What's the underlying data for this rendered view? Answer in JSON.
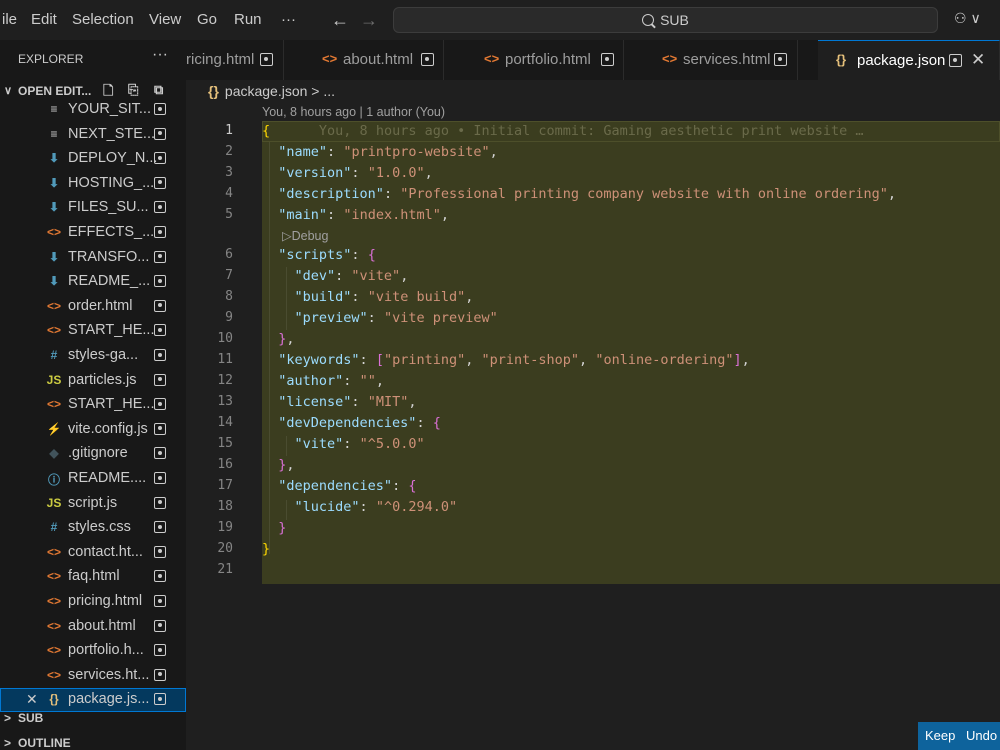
{
  "menu": {
    "file": "ile",
    "edit": "Edit",
    "selection": "Selection",
    "view": "View",
    "go": "Go",
    "run": "Run",
    "more": "···"
  },
  "nav": {
    "back": "←",
    "forward": "→"
  },
  "search": {
    "label": "SUB"
  },
  "copilot": {
    "label": "⚇ ∨"
  },
  "sidebar": {
    "title": "EXPLORER",
    "more": "···",
    "open_editors": "OPEN EDIT...",
    "files": [
      {
        "name": "YOUR_SIT...",
        "icon": "≡",
        "color": "#cccccc",
        "icon_name": "text-file-icon"
      },
      {
        "name": "NEXT_STE...",
        "icon": "≡",
        "color": "#cccccc",
        "icon_name": "text-file-icon"
      },
      {
        "name": "DEPLOY_N...",
        "icon": "⬇",
        "color": "#519aba",
        "icon_name": "markdown-icon"
      },
      {
        "name": "HOSTING_...",
        "icon": "⬇",
        "color": "#519aba",
        "icon_name": "markdown-icon"
      },
      {
        "name": "FILES_SU...",
        "icon": "⬇",
        "color": "#519aba",
        "icon_name": "markdown-icon"
      },
      {
        "name": "EFFECTS_...",
        "icon": "<>",
        "color": "#e37933",
        "icon_name": "html-icon"
      },
      {
        "name": "TRANSFO...",
        "icon": "⬇",
        "color": "#519aba",
        "icon_name": "markdown-icon"
      },
      {
        "name": "README_...",
        "icon": "⬇",
        "color": "#519aba",
        "icon_name": "markdown-icon"
      },
      {
        "name": "order.html",
        "icon": "<>",
        "color": "#e37933",
        "icon_name": "html-icon"
      },
      {
        "name": "START_HE...",
        "icon": "<>",
        "color": "#e37933",
        "icon_name": "html-icon"
      },
      {
        "name": "styles-ga...",
        "icon": "#",
        "color": "#519aba",
        "icon_name": "css-icon"
      },
      {
        "name": "particles.js",
        "icon": "JS",
        "color": "#cbcb41",
        "icon_name": "js-icon"
      },
      {
        "name": "START_HE...",
        "icon": "<>",
        "color": "#e37933",
        "icon_name": "html-icon"
      },
      {
        "name": "vite.config.js",
        "icon": "⚡",
        "color": "#cbcb41",
        "icon_name": "vite-icon"
      },
      {
        "name": ".gitignore",
        "icon": "◆",
        "color": "#41535b",
        "icon_name": "git-icon"
      },
      {
        "name": "README....",
        "icon": "ⓘ",
        "color": "#519aba",
        "icon_name": "info-icon"
      },
      {
        "name": "script.js",
        "icon": "JS",
        "color": "#cbcb41",
        "icon_name": "js-icon"
      },
      {
        "name": "styles.css",
        "icon": "#",
        "color": "#519aba",
        "icon_name": "css-icon"
      },
      {
        "name": "contact.ht...",
        "icon": "<>",
        "color": "#e37933",
        "icon_name": "html-icon"
      },
      {
        "name": "faq.html",
        "icon": "<>",
        "color": "#e37933",
        "icon_name": "html-icon"
      },
      {
        "name": "pricing.html",
        "icon": "<>",
        "color": "#e37933",
        "icon_name": "html-icon"
      },
      {
        "name": "about.html",
        "icon": "<>",
        "color": "#e37933",
        "icon_name": "html-icon"
      },
      {
        "name": "portfolio.h...",
        "icon": "<>",
        "color": "#e37933",
        "icon_name": "html-icon"
      },
      {
        "name": "services.ht...",
        "icon": "<>",
        "color": "#e37933",
        "icon_name": "html-icon"
      },
      {
        "name": "package.js...",
        "icon": "{}",
        "color": "#e5c07b",
        "icon_name": "json-icon",
        "active": true
      }
    ],
    "sections": {
      "sub": "SUB",
      "outline": "OUTLINE"
    }
  },
  "tabs": [
    {
      "name": "ricing.html",
      "icon": ""
    },
    {
      "name": "about.html",
      "icon": "<>"
    },
    {
      "name": "portfolio.html",
      "icon": "<>"
    },
    {
      "name": "services.html",
      "icon": "<>"
    },
    {
      "name": "package.json",
      "icon": "{}",
      "active": true
    }
  ],
  "breadcrumb": {
    "icon": "{}",
    "text": "package.json > ..."
  },
  "blame": "You, 8 hours ago | 1 author (You)",
  "codelens": "▷Debug",
  "ghost_text": "You, 8 hours ago • Initial commit: Gaming aesthetic print website …",
  "code_lines": [
    {
      "n": "1"
    },
    {
      "n": "2"
    },
    {
      "n": "3"
    },
    {
      "n": "4"
    },
    {
      "n": "5"
    },
    {
      "n": "6"
    },
    {
      "n": "7"
    },
    {
      "n": "8"
    },
    {
      "n": "9"
    },
    {
      "n": "10"
    },
    {
      "n": "11"
    },
    {
      "n": "12"
    },
    {
      "n": "13"
    },
    {
      "n": "14"
    },
    {
      "n": "15"
    },
    {
      "n": "16"
    },
    {
      "n": "17"
    },
    {
      "n": "18"
    },
    {
      "n": "19"
    },
    {
      "n": "20"
    },
    {
      "n": "21"
    }
  ],
  "code": {
    "name_key": "\"name\"",
    "name_val": "\"printpro-website\"",
    "version_key": "\"version\"",
    "version_val": "\"1.0.0\"",
    "desc_key": "\"description\"",
    "desc_val": "\"Professional printing company website with online ordering\"",
    "main_key": "\"main\"",
    "main_val": "\"index.html\"",
    "scripts_key": "\"scripts\"",
    "dev_key": "\"dev\"",
    "dev_val": "\"vite\"",
    "build_key": "\"build\"",
    "build_val": "\"vite build\"",
    "preview_key": "\"preview\"",
    "preview_val": "\"vite preview\"",
    "keywords_key": "\"keywords\"",
    "kw1": "\"printing\"",
    "kw2": "\"print-shop\"",
    "kw3": "\"online-ordering\"",
    "author_key": "\"author\"",
    "author_val": "\"\"",
    "license_key": "\"license\"",
    "license_val": "\"MIT\"",
    "devdeps_key": "\"devDependencies\"",
    "vite_key": "\"vite\"",
    "vite_val": "\"^5.0.0\"",
    "deps_key": "\"dependencies\"",
    "lucide_key": "\"lucide\"",
    "lucide_val": "\"^0.294.0\""
  },
  "keepbar": {
    "keep": "Keep",
    "undo": "Undo"
  }
}
